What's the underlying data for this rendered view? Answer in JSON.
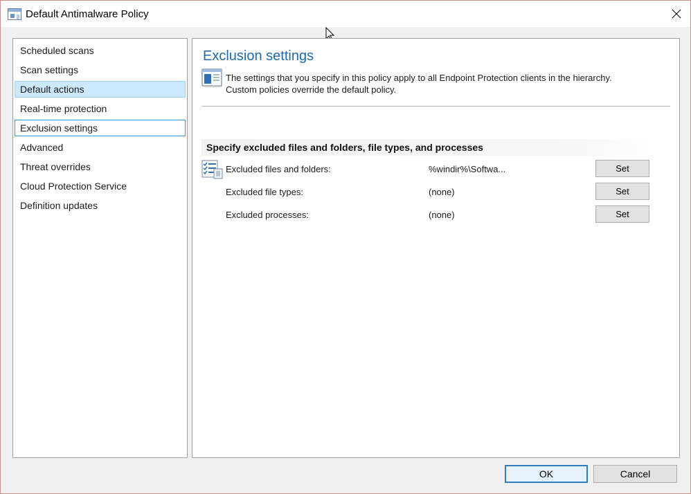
{
  "window": {
    "title": "Default Antimalware Policy",
    "title_icon": "policy-window-icon",
    "close_icon": "close-icon"
  },
  "sidebar": {
    "items": [
      {
        "label": "Scheduled scans",
        "state": "normal"
      },
      {
        "label": "Scan settings",
        "state": "normal"
      },
      {
        "label": "Default actions",
        "state": "selected"
      },
      {
        "label": "Real-time protection",
        "state": "normal"
      },
      {
        "label": "Exclusion settings",
        "state": "focused"
      },
      {
        "label": "Advanced",
        "state": "normal"
      },
      {
        "label": "Threat overrides",
        "state": "normal"
      },
      {
        "label": "Cloud Protection Service",
        "state": "normal"
      },
      {
        "label": "Definition updates",
        "state": "normal"
      }
    ]
  },
  "main": {
    "title": "Exclusion settings",
    "info_icon": "policy-info-icon",
    "info_text_line1": "The settings that you specify in this policy apply to all Endpoint Protection clients in the hierarchy.",
    "info_text_line2": "Custom policies override the default policy.",
    "section_header": "Specify excluded files and folders, file types, and processes",
    "section_icon": "checklist-icon",
    "rows": [
      {
        "label": "Excluded files and folders:",
        "value": "%windir%\\Softwa...",
        "button": "Set"
      },
      {
        "label": "Excluded file types:",
        "value": "(none)",
        "button": "Set"
      },
      {
        "label": "Excluded processes:",
        "value": "(none)",
        "button": "Set"
      }
    ]
  },
  "footer": {
    "ok_label": "OK",
    "cancel_label": "Cancel"
  },
  "colors": {
    "title_blue": "#1e6aa8",
    "selected_bg": "#cce8ff",
    "focus_border": "#3399ff",
    "default_button_border": "#2f7cc1"
  }
}
